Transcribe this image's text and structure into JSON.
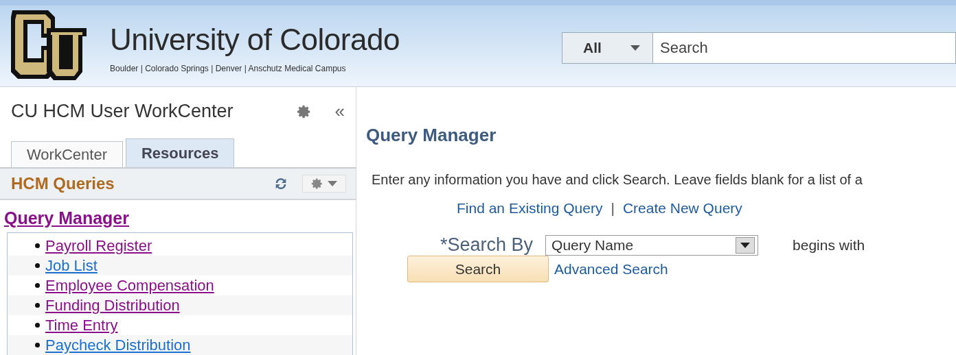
{
  "header": {
    "title": "University of Colorado",
    "campuses": "Boulder | Colorado Springs | Denver | Anschutz Medical Campus",
    "search_scope": "All",
    "search_placeholder": "Search"
  },
  "sidebar": {
    "title": "CU HCM User WorkCenter",
    "collapse_glyph": "«",
    "tabs": [
      {
        "label": "WorkCenter",
        "selected": false
      },
      {
        "label": "Resources",
        "selected": true
      }
    ],
    "section": "HCM Queries",
    "section_link": {
      "label": "Query Manager",
      "visited": true
    },
    "items": [
      {
        "label": "Payroll Register",
        "visited": true
      },
      {
        "label": "Job List",
        "visited": false
      },
      {
        "label": "Employee Compensation",
        "visited": true
      },
      {
        "label": "Funding Distribution",
        "visited": true
      },
      {
        "label": "Time Entry",
        "visited": true
      },
      {
        "label": "Paycheck Distribution",
        "visited": false
      }
    ]
  },
  "main": {
    "title": "Query Manager",
    "instructions": "Enter any information you have and click Search. Leave fields blank for a list of a",
    "links": [
      "Find an Existing Query",
      "Create New Query"
    ],
    "separator": "|",
    "search_by_label": "*Search By",
    "search_by_value": "Query Name",
    "operator": "begins with",
    "search_button": "Search",
    "advanced_link": "Advanced Search"
  }
}
